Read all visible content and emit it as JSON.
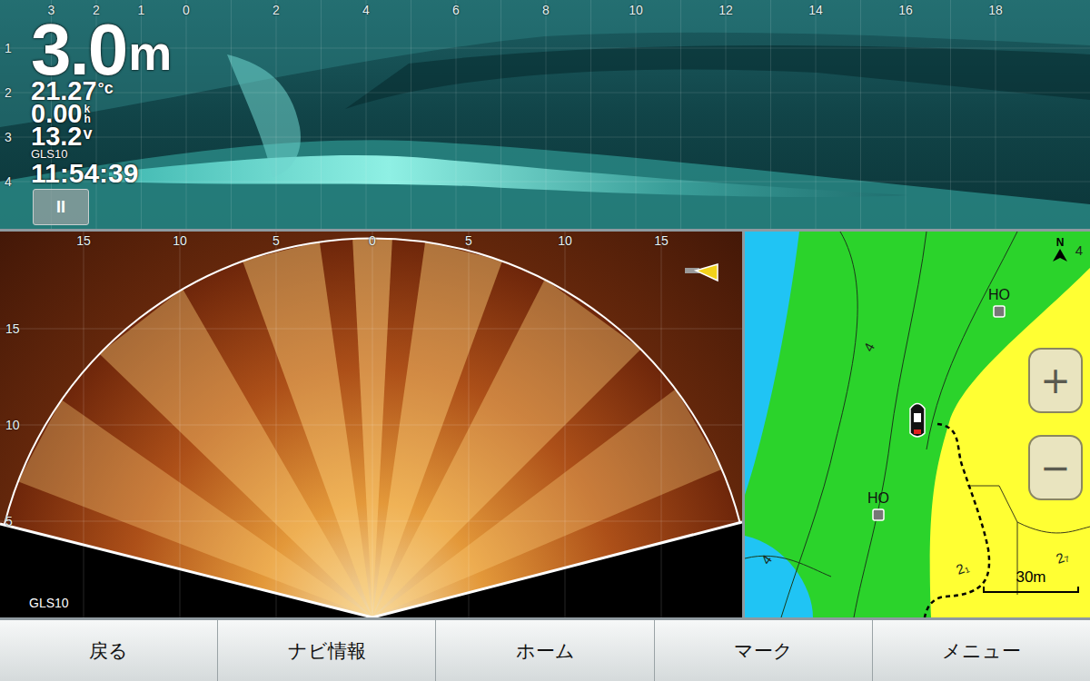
{
  "sonar2d": {
    "range_ticks": [
      {
        "label": "3",
        "value": -3
      },
      {
        "label": "2",
        "value": -2
      },
      {
        "label": "1",
        "value": -1
      },
      {
        "label": "0",
        "value": 0
      },
      {
        "label": "2",
        "value": 2
      },
      {
        "label": "4",
        "value": 4
      },
      {
        "label": "6",
        "value": 6
      },
      {
        "label": "8",
        "value": 8
      },
      {
        "label": "10",
        "value": 10
      },
      {
        "label": "12",
        "value": 12
      },
      {
        "label": "14",
        "value": 14
      },
      {
        "label": "16",
        "value": 16
      },
      {
        "label": "18",
        "value": 18
      }
    ],
    "depth_ticks": [
      {
        "label": "1",
        "value": 1
      },
      {
        "label": "2",
        "value": 2
      },
      {
        "label": "3",
        "value": 3
      },
      {
        "label": "4",
        "value": 4
      }
    ],
    "depth": {
      "value": "3.0",
      "unit": "m"
    },
    "temperature": {
      "value": "21.27",
      "unit": "°c"
    },
    "speed": {
      "value": "0.00",
      "unit_top": "k",
      "unit_bottom": "h"
    },
    "voltage": {
      "value": "13.2",
      "unit": "v"
    },
    "source": "GLS10",
    "time": "11:54:39",
    "pause_button": "II"
  },
  "livescope": {
    "range_ticks": [
      {
        "label": "15",
        "value": -15
      },
      {
        "label": "10",
        "value": -10
      },
      {
        "label": "5",
        "value": -5
      },
      {
        "label": "0",
        "value": 0
      },
      {
        "label": "5",
        "value": 5
      },
      {
        "label": "10",
        "value": 10
      },
      {
        "label": "15",
        "value": 15
      }
    ],
    "depth_ticks": [
      {
        "label": "15",
        "value": 15
      },
      {
        "label": "10",
        "value": 10
      },
      {
        "label": "5",
        "value": 5
      }
    ],
    "source": "GLS10"
  },
  "map": {
    "markers": [
      {
        "label": "HO"
      },
      {
        "label": "HO"
      }
    ],
    "contour_labels": [
      "4",
      "4",
      "2₁",
      "2₇",
      "4"
    ],
    "north": "N",
    "zoom_in": "+",
    "zoom_out": "−",
    "scale": "30m"
  },
  "buttons": [
    {
      "label": "戻る"
    },
    {
      "label": "ナビ情報"
    },
    {
      "label": "ホーム"
    },
    {
      "label": "マーク"
    },
    {
      "label": "メニュー"
    }
  ]
}
